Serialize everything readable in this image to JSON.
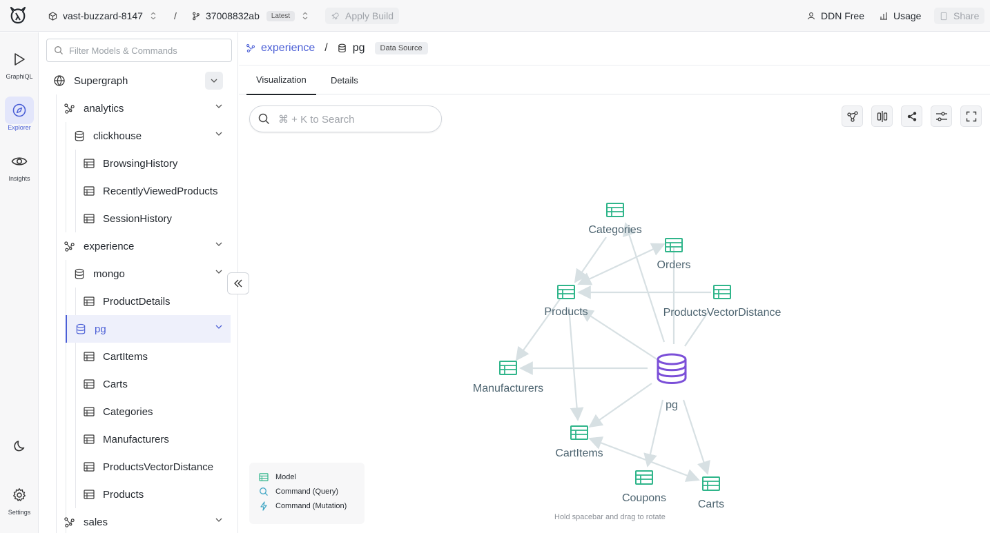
{
  "topbar": {
    "project": "vast-buzzard-8147",
    "build_id": "37008832ab",
    "build_badge": "Latest",
    "apply_build": "Apply Build",
    "plan": "DDN Free",
    "usage": "Usage",
    "share": "Share"
  },
  "rail": {
    "graphiql": "GraphiQL",
    "explorer": "Explorer",
    "insights": "Insights",
    "settings": "Settings"
  },
  "sidebar": {
    "filter_placeholder": "Filter Models & Commands",
    "supergraph": "Supergraph",
    "analytics": "analytics",
    "clickhouse": "clickhouse",
    "browsing_history": "BrowsingHistory",
    "recently_viewed": "RecentlyViewedProducts",
    "session_history": "SessionHistory",
    "experience": "experience",
    "mongo": "mongo",
    "product_details": "ProductDetails",
    "pg": "pg",
    "cart_items": "CartItems",
    "carts": "Carts",
    "categories": "Categories",
    "manufacturers": "Manufacturers",
    "products_vector_distance": "ProductsVectorDistance",
    "products": "Products",
    "sales": "sales"
  },
  "breadcrumb": {
    "subgraph": "experience",
    "separator": "/",
    "source": "pg",
    "source_badge": "Data Source"
  },
  "tabs": {
    "visualization": "Visualization",
    "details": "Details"
  },
  "search": {
    "placeholder": "⌘ + K to Search"
  },
  "graph": {
    "nodes": {
      "categories": "Categories",
      "orders": "Orders",
      "products": "Products",
      "products_vector_distance": "ProductsVectorDistance",
      "manufacturers": "Manufacturers",
      "pg": "pg",
      "cart_items": "CartItems",
      "coupons": "Coupons",
      "carts": "Carts"
    }
  },
  "legend": {
    "model": "Model",
    "command_query": "Command (Query)",
    "command_mutation": "Command (Mutation)"
  },
  "hint": "Hold spacebar and drag to rotate",
  "colors": {
    "accent": "#4b5fd6",
    "model_green": "#2fb58a",
    "datasource_purple": "#7b4fd8",
    "edge_gray": "#cfd8dc"
  }
}
